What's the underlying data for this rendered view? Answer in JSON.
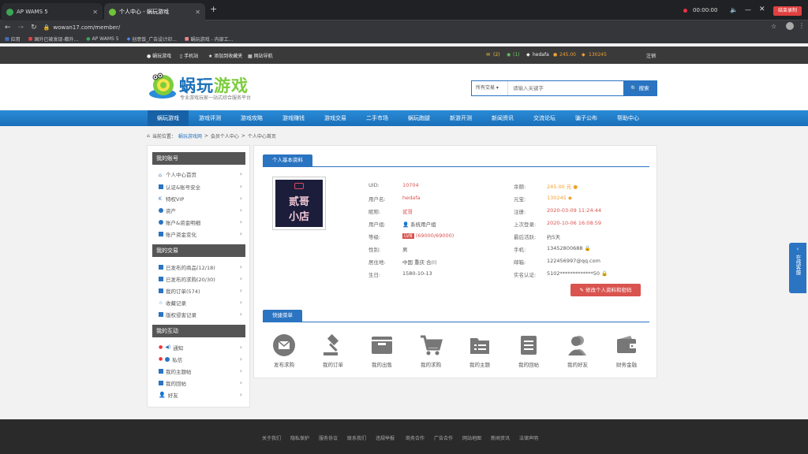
{
  "browser": {
    "tabs": [
      {
        "title": "AP WAMS 5"
      },
      {
        "title": "个人中心 - 蜗玩游戏"
      }
    ],
    "new_tab": "+",
    "url": "wowan17.com/member/",
    "timer": "00:00:00",
    "rec_label": "结束录制"
  },
  "bookmarks": [
    {
      "label": "应用"
    },
    {
      "label": "国外已被发现-都外..."
    },
    {
      "label": "AP WAMS 5"
    },
    {
      "label": "创意饭_广告设计印..."
    },
    {
      "label": "蜗玩游戏 - 内部工..."
    }
  ],
  "topbar": {
    "left_links": [
      "蜗玩游戏",
      "手机站",
      "添加到收藏夹",
      "网站导航"
    ],
    "msg_count": "(2)",
    "msg_count2": "(1)",
    "username": "hedafa",
    "coin_value": "245.00",
    "point_value": "130245",
    "logout": "注销"
  },
  "header": {
    "logo_text_a": "蜗玩",
    "logo_text_b": "游戏",
    "slogan": "专业游戏玩家一站式综合服务平台",
    "search_select": "所有交易",
    "search_placeholder": "请输入关键字",
    "search_button": "搜索"
  },
  "nav": [
    "蜗玩游戏",
    "游戏评测",
    "游戏攻略",
    "游戏赚钱",
    "游戏交易",
    "二手市场",
    "蜗玩跑腿",
    "新游开测",
    "新闻资讯",
    "交流论坛",
    "骗子公布",
    "帮助中心"
  ],
  "breadcrumb": {
    "prefix": "当前位置：",
    "items": [
      "蜗玩游戏网",
      "会员个人中心",
      "个人中心首页"
    ]
  },
  "sidebar": {
    "sections": [
      {
        "title": "我的账号",
        "items": [
          "个人中心首页",
          "认证&账号安全",
          "特权VIP",
          "资产",
          "账户&资金明细",
          "账户资金变化"
        ]
      },
      {
        "title": "我的交易",
        "items": [
          "已发布的商品(12/18)",
          "已发布的求购(20/30)",
          "我的订单(574)",
          "收藏记录",
          "版权侵害记录"
        ]
      },
      {
        "title": "我的互动",
        "items": [
          "通知",
          "私信",
          "我的主题帖",
          "我的回帖",
          "好友"
        ]
      }
    ]
  },
  "profile": {
    "section_title": "个人基本资料",
    "avatar_line1": "贰哥",
    "avatar_line2": "小店",
    "left_labels": [
      "UID:",
      "用户名:",
      "昵称:",
      "用户组:",
      "等级:",
      "性别:",
      "居住地:",
      "生日:"
    ],
    "left_values": [
      "10704",
      "hedafa",
      "贰哥",
      "系统用户组",
      "",
      "男",
      "中国 重庆 合川",
      "1580-10-13"
    ],
    "level_badge": "LV8",
    "level_text": "(69000/69000)",
    "right_labels": [
      "余额:",
      "元宝:",
      "注册:",
      "上次登录:",
      "最后活跃:",
      "手机:",
      "邮箱:",
      "实名认证:"
    ],
    "right_values": [
      "245.00 元",
      "130245",
      "2020-03-09 11:24:44",
      "2020-10-06 16:08:59",
      "约5天",
      "13452800688",
      "122456997@qq.com",
      "5102*************50"
    ],
    "edit_button": "修改个人资料和密码"
  },
  "quick": {
    "section_title": "快捷菜单",
    "items": [
      "发布求购",
      "我的订单",
      "我的出售",
      "我的求购",
      "我的主题",
      "我的回帖",
      "我的好友",
      "财务金融"
    ]
  },
  "footer_links": [
    "关于我们",
    "隐私保护",
    "服务协议",
    "联系我们",
    "违规举报",
    "商务合作",
    "广告合作",
    "网站地图",
    "新闻资讯",
    "法律声明"
  ],
  "side_tab": "在线客服"
}
